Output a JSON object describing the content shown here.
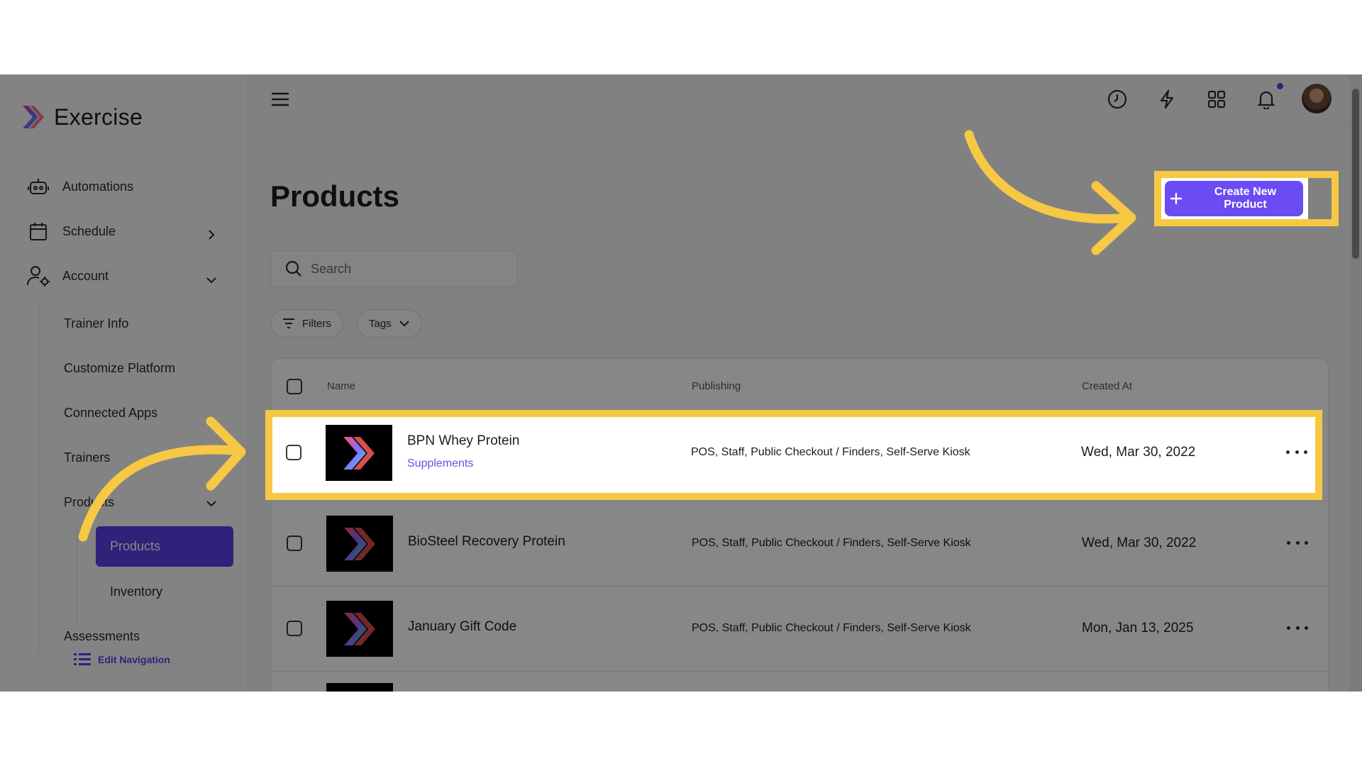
{
  "app": {
    "name": "Exercise"
  },
  "sidebar": {
    "items": [
      {
        "label": "Automations",
        "icon": "robot-icon"
      },
      {
        "label": "Schedule",
        "icon": "calendar-icon"
      },
      {
        "label": "Account",
        "icon": "user-gear-icon"
      }
    ],
    "account_sub": [
      "Trainer Info",
      "Customize Platform",
      "Connected Apps",
      "Trainers",
      "Products"
    ],
    "products_sub": [
      "Products",
      "Inventory"
    ],
    "assessments": "Assessments",
    "edit_navigation": "Edit Navigation"
  },
  "header": {
    "icons": [
      "clock-icon",
      "bolt-icon",
      "apps-grid-icon",
      "bell-icon"
    ]
  },
  "main": {
    "title": "Products",
    "create_button": "Create New Product",
    "search_placeholder": "Search",
    "filters_label": "Filters",
    "tags_label": "Tags",
    "columns": [
      "Name",
      "Publishing",
      "Created At"
    ],
    "rows": [
      {
        "name": "BPN Whey Protein",
        "category": "Supplements",
        "publishing": "POS, Staff, Public Checkout / Finders, Self-Serve Kiosk",
        "created": "Wed, Mar 30, 2022"
      },
      {
        "name": "BioSteel Recovery Protein",
        "category": "",
        "publishing": "POS, Staff, Public Checkout / Finders, Self-Serve Kiosk",
        "created": "Wed, Mar 30, 2022"
      },
      {
        "name": "January Gift Code",
        "category": "",
        "publishing": "POS, Staff, Public Checkout / Finders, Self-Serve Kiosk",
        "created": "Mon, Jan 13, 2025"
      }
    ]
  },
  "colors": {
    "accent": "#6a4cf2",
    "highlight": "#f6c844"
  }
}
